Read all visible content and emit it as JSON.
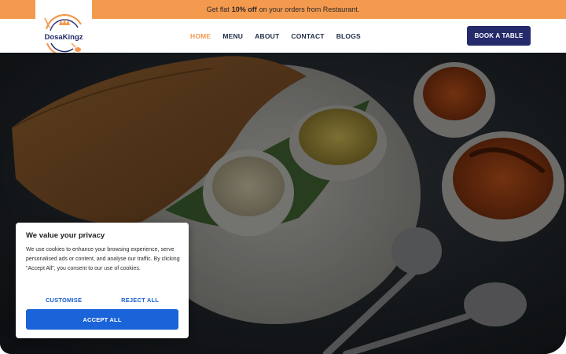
{
  "promo": {
    "text_before": "Get flat",
    "highlight": "10% off",
    "text_after": "on your orders from Restaurant."
  },
  "brand": {
    "name": "DosaKingz",
    "icon": "crown-plate-logo"
  },
  "nav": {
    "links": [
      {
        "label": "HOME",
        "active": true
      },
      {
        "label": "MENU",
        "active": false
      },
      {
        "label": "ABOUT",
        "active": false
      },
      {
        "label": "CONTACT",
        "active": false
      },
      {
        "label": "BLOGS",
        "active": false
      }
    ],
    "cta": "BOOK A TABLE"
  },
  "hero": {
    "image": "dosa-with-chutney-and-sambar-photo"
  },
  "cookie_banner": {
    "title": "We value your privacy",
    "body": "We use cookies to enhance your browsing experience, serve personalised ads or content, and analyse our traffic. By clicking \"Accept All\", you consent to our use of cookies.",
    "customise_label": "CUSTOMISE",
    "reject_label": "REJECT ALL",
    "accept_label": "ACCEPT ALL"
  },
  "colors": {
    "promo_bg": "#f49a4f",
    "nav_active": "#f49a4f",
    "cta_bg": "#252a6b",
    "cookie_accent": "#1a63d8"
  }
}
